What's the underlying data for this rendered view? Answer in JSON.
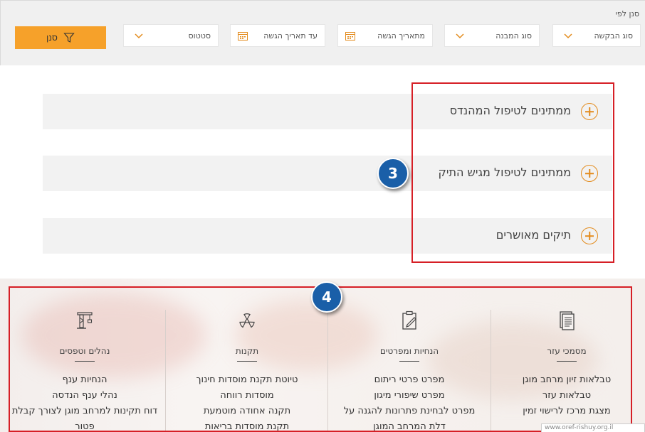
{
  "filter_bar": {
    "filter_by_label": "סנן לפי",
    "request_type": "סוג הבקשה",
    "building_type": "סוג המבנה",
    "from_date": "מתאריך הגשה",
    "to_date": "עד תאריך הגשה",
    "status": "סטטוס",
    "filter_button": "סנן"
  },
  "accordion": {
    "items": [
      {
        "label": "ממתינים לטיפול המהנדס"
      },
      {
        "label": "ממתינים לטיפול מגיש התיק"
      },
      {
        "label": "תיקים מאושרים"
      }
    ]
  },
  "badges": {
    "three": "3",
    "four": "4"
  },
  "columns": [
    {
      "icon": "document-icon",
      "title": "מסמכי עזר",
      "links": [
        "טבלאות זיון מרחב מוגן",
        "טבלאות עזר",
        "מצגת מרכז לרישוי זמין"
      ]
    },
    {
      "icon": "clipboard-edit-icon",
      "title": "הנחיות ומפרטים",
      "links": [
        "מפרט פרטי ריתום",
        "מפרט שיפורי מיגון",
        "מפרט לבחינת פתרונות להגנה על",
        "דלת המרחב המוגן"
      ]
    },
    {
      "icon": "radiation-icon",
      "title": "תקנות",
      "links": [
        "טיוטת תקנת מוסדות חינוך",
        "מוסדות רווחה",
        "תקנה אחודה מוטמעת",
        "תקנת מוסדות בריאות"
      ]
    },
    {
      "icon": "crane-icon",
      "title": "נהלים וטפסים",
      "links": [
        "הנחיות ענף",
        "נהלי ענף הנדסה",
        "דוח תקינות למרחב מוגן לצורך קבלת",
        "פטור"
      ]
    }
  ],
  "status_bar": {
    "url": "www.oref-rishuy.org.il"
  },
  "colors": {
    "accent": "#f6a12a",
    "highlight": "#d61f26",
    "badge": "#1a5fa8"
  }
}
